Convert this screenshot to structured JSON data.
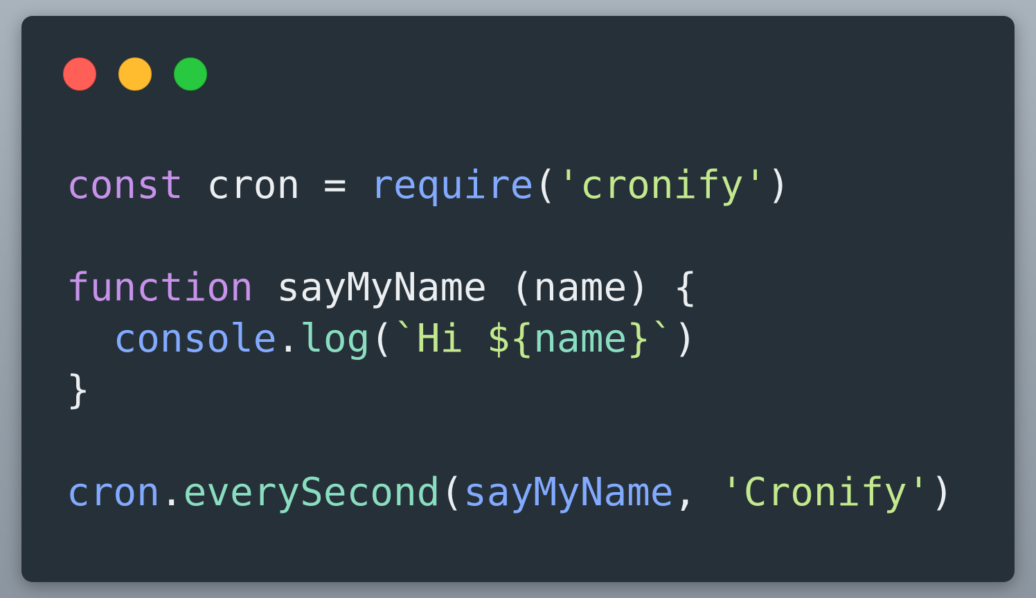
{
  "window": {
    "controls": {
      "close_color": "#ff5f57",
      "minimize_color": "#febc2e",
      "maximize_color": "#28c840"
    }
  },
  "code": {
    "language": "javascript",
    "theme_colors": {
      "background": "#263038",
      "keyword": "#c792ea",
      "function": "#82aaff",
      "string": "#c3e88d",
      "method": "#89ddc0",
      "text": "#eceff1"
    },
    "lines": [
      {
        "tokens": {
          "t1": "const",
          "t2": " cron = ",
          "t3": "require",
          "t4": "(",
          "t5": "'cronify'",
          "t6": ")"
        }
      },
      {
        "tokens": {}
      },
      {
        "tokens": {
          "t1": "function",
          "t2": " sayMyName (name) {"
        }
      },
      {
        "tokens": {
          "t1": "  ",
          "t2": "console",
          "t3": ".",
          "t4": "log",
          "t5": "(",
          "t6": "`Hi ${",
          "t7": "name",
          "t8": "}`",
          "t9": ")"
        }
      },
      {
        "tokens": {
          "t1": "}"
        }
      },
      {
        "tokens": {}
      },
      {
        "tokens": {
          "t1": "cron",
          "t2": ".",
          "t3": "everySecond",
          "t4": "(",
          "t5": "sayMyName",
          "t6": ", ",
          "t7": "'Cronify'",
          "t8": ")"
        }
      }
    ]
  }
}
